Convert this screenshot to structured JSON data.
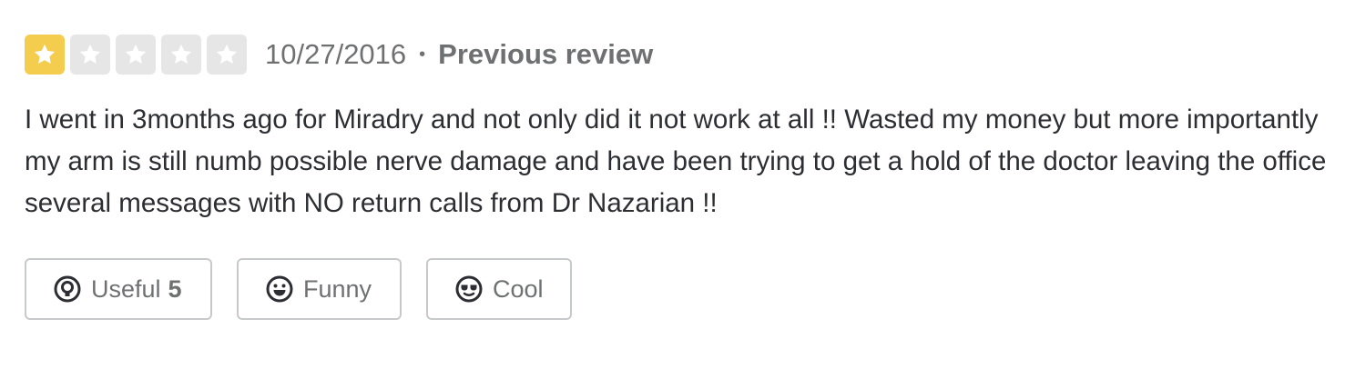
{
  "review": {
    "rating": 1,
    "rating_max": 5,
    "date": "10/27/2016",
    "separator": "•",
    "previous_review_label": "Previous review",
    "text": "I went in 3months ago for Miradry and not only did it not work at all !! Wasted my money but more importantly my arm is still numb possible nerve damage and have been trying to get a hold of the doctor leaving the office several messages with NO return calls from Dr Nazarian !!"
  },
  "actions": {
    "useful_label": "Useful",
    "useful_count": "5",
    "funny_label": "Funny",
    "cool_label": "Cool"
  },
  "colors": {
    "star_filled": "#f4cd4e",
    "star_empty": "#e6e6e6",
    "text": "#2d2e33",
    "muted": "#6e7072",
    "button_border": "#c8c9ca"
  },
  "icons": {
    "useful": "lightbulb-icon",
    "funny": "laughing-face-icon",
    "cool": "sunglasses-face-icon",
    "star": "star-icon"
  }
}
